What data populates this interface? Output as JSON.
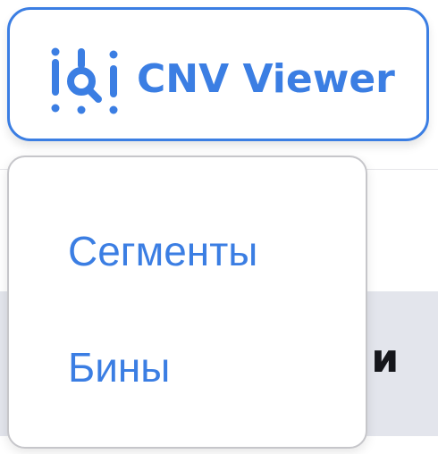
{
  "app": {
    "title": "CNV Viewer",
    "icon": "cnv-viewer-logo-icon",
    "accent_color": "#3b7ee3"
  },
  "dropdown": {
    "items": [
      {
        "label": "Сегменты"
      },
      {
        "label": "Бины"
      }
    ]
  },
  "background": {
    "table_header_fragment": "ни"
  }
}
